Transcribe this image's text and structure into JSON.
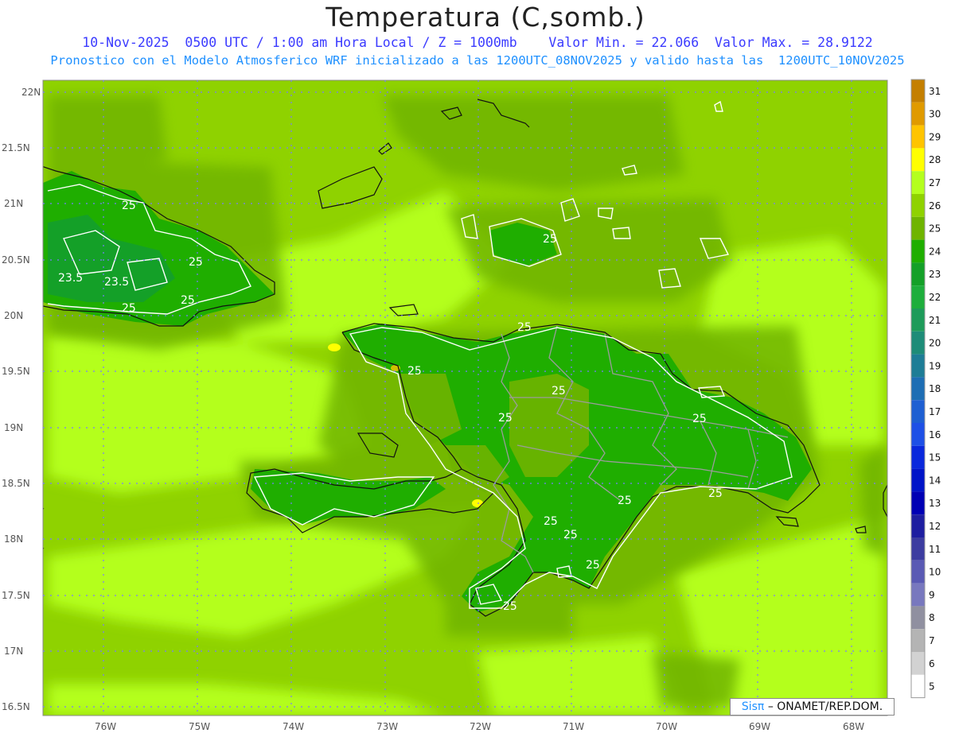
{
  "title": "Temperatura (C,somb.)",
  "subtitle_line1": "10-Nov-2025  0500 UTC / 1:00 am Hora Local / Z = 1000mb    Valor Min. = 22.066  Valor Max. = 28.9122",
  "subtitle_line2": "Pronostico con el Modelo Atmosferico WRF inicializado a las 1200UTC_08NOV2025 y valido hasta las  1200UTC_10NOV2025",
  "map": {
    "lat_labels": [
      "22N",
      "21.5N",
      "21N",
      "20.5N",
      "20N",
      "19.5N",
      "19N",
      "18.5N",
      "18N",
      "17.5N",
      "17N",
      "16.5N"
    ],
    "lon_labels": [
      "76W",
      "75W",
      "74W",
      "73W",
      "72W",
      "71W",
      "70W",
      "69W",
      "68W"
    ],
    "contour_labels": [
      "25",
      "25",
      "25",
      "23.5",
      "23.5",
      "25",
      "25",
      "25",
      "25",
      "25",
      "25",
      "25",
      "25",
      "25",
      "25",
      "25",
      "25",
      "25"
    ]
  },
  "colorbar": {
    "levels": [
      "31",
      "30",
      "29",
      "28",
      "27",
      "26",
      "25",
      "24",
      "23",
      "22",
      "21",
      "20",
      "19",
      "18",
      "17",
      "16",
      "15",
      "14",
      "13",
      "12",
      "11",
      "10",
      "9",
      "8",
      "7",
      "6",
      "5"
    ],
    "colors": [
      "#c47f00",
      "#e09a00",
      "#ffc400",
      "#ffff00",
      "#b4ff1e",
      "#8fd200",
      "#6fb400",
      "#1fae00",
      "#14a028",
      "#1eae3c",
      "#1e9b5a",
      "#1e8c78",
      "#1e7d96",
      "#1e6eb4",
      "#1e5fd2",
      "#1e50e6",
      "#0a28dc",
      "#0014c8",
      "#0000b4",
      "#1e1ea0",
      "#3c3ca0",
      "#5a5ab4",
      "#7878be",
      "#9090a0",
      "#b4b4b4",
      "#d2d2d2",
      "#ffffff"
    ]
  },
  "credit": {
    "sis": "Sisπ",
    "rest": "– ONAMET/REP.DOM."
  }
}
